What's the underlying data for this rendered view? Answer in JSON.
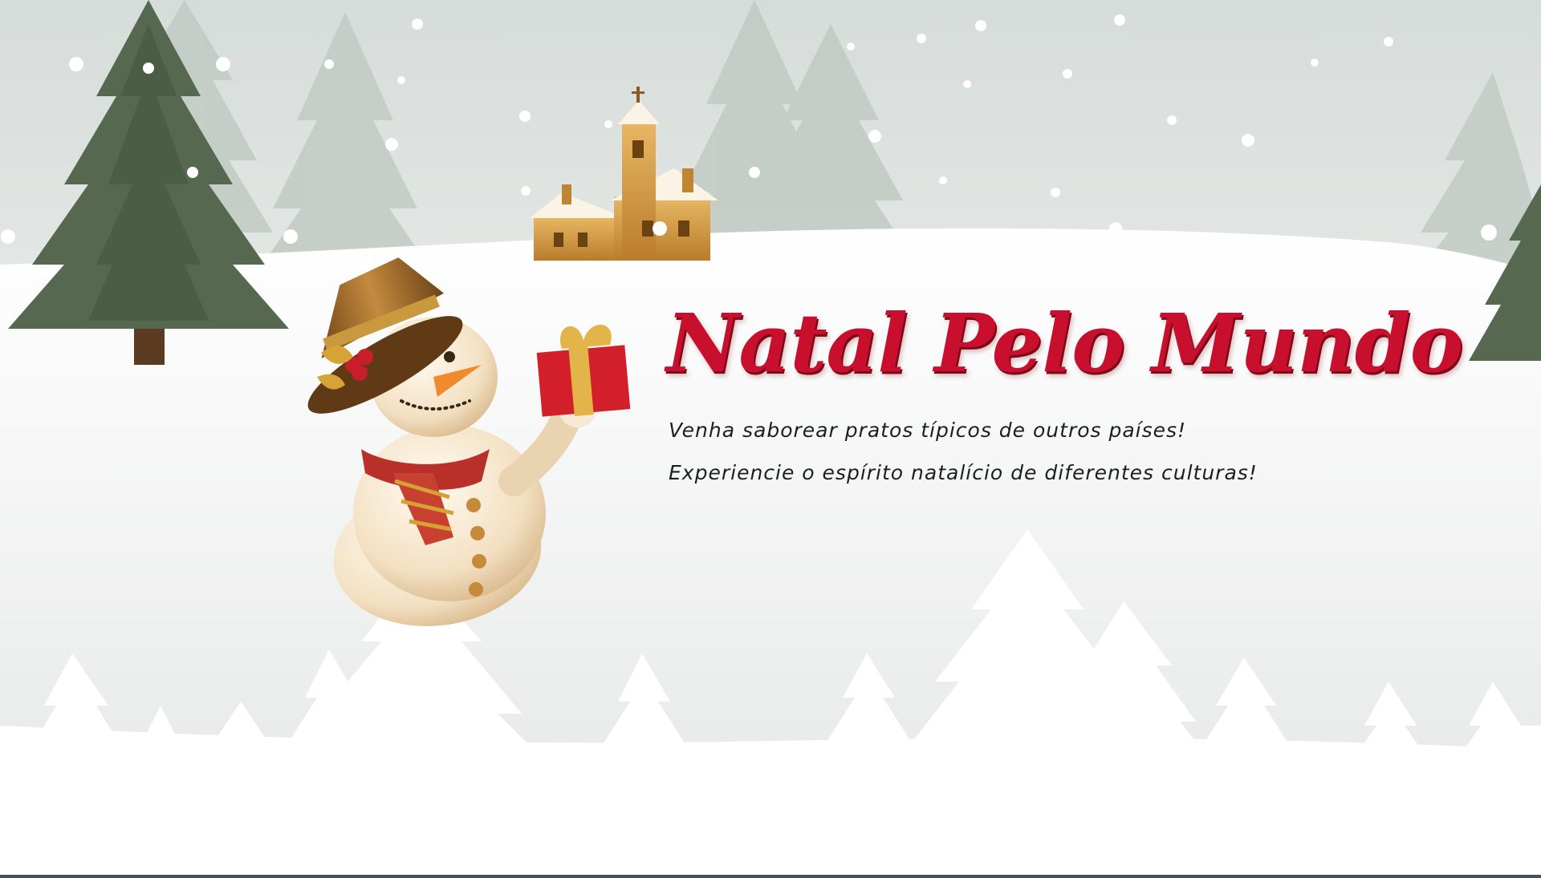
{
  "banner": {
    "title": "Natal Pelo Mundo",
    "subtitle_line1": "Venha saborear pratos típicos de outros países!",
    "subtitle_line2": "Experiencie o espírito natalício de diferentes culturas!"
  },
  "illustration": {
    "subject": [
      "snowman-icon",
      "gift-box-icon",
      "church-icon",
      "pine-tree-icon",
      "snowflake-icon"
    ]
  },
  "colors": {
    "title": "#c8102e",
    "sky": "#d6ddd9",
    "snow": "#ffffff",
    "pine": "#56684f",
    "church": "#d7a14a"
  }
}
